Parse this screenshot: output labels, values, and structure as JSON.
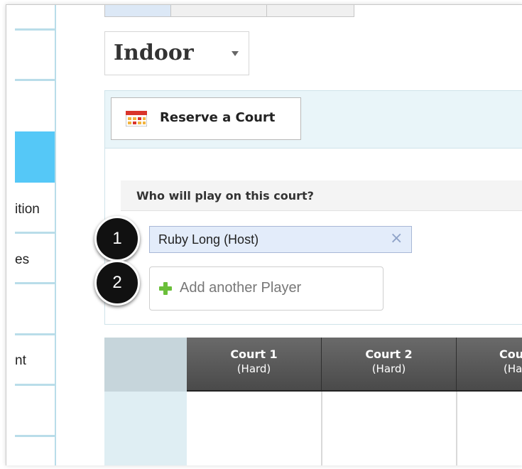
{
  "sidebar": {
    "items": [
      {
        "label": ""
      },
      {
        "label": ""
      },
      {
        "label": ""
      },
      {
        "label": "ition"
      },
      {
        "label": "es"
      },
      {
        "label": ""
      },
      {
        "label": "nt"
      }
    ]
  },
  "venue": {
    "selected": "Indoor"
  },
  "reserve": {
    "button_label": "Reserve a Court"
  },
  "players": {
    "prompt": "Who will play on this court?",
    "list": [
      {
        "name": "Ruby Long (Host)",
        "remove_glyph": "×"
      }
    ],
    "add_label": "Add another Player"
  },
  "steps": [
    "1",
    "2"
  ],
  "courts": [
    {
      "name": "Court 1",
      "surface": "(Hard)"
    },
    {
      "name": "Court 2",
      "surface": "(Hard)"
    },
    {
      "name": "Cou",
      "surface": "(Ha"
    }
  ],
  "icons": {
    "calendar": "calendar-icon",
    "plus": "plus-icon",
    "remove": "close-icon",
    "dropdown": "chevron-down-icon"
  },
  "colors": {
    "sidebar_active": "#55c8f7",
    "panel_head": "#e9f5f9",
    "chip_bg": "#e3ecfa",
    "plus_green": "#6bbf3a",
    "court_header": "#555555"
  }
}
